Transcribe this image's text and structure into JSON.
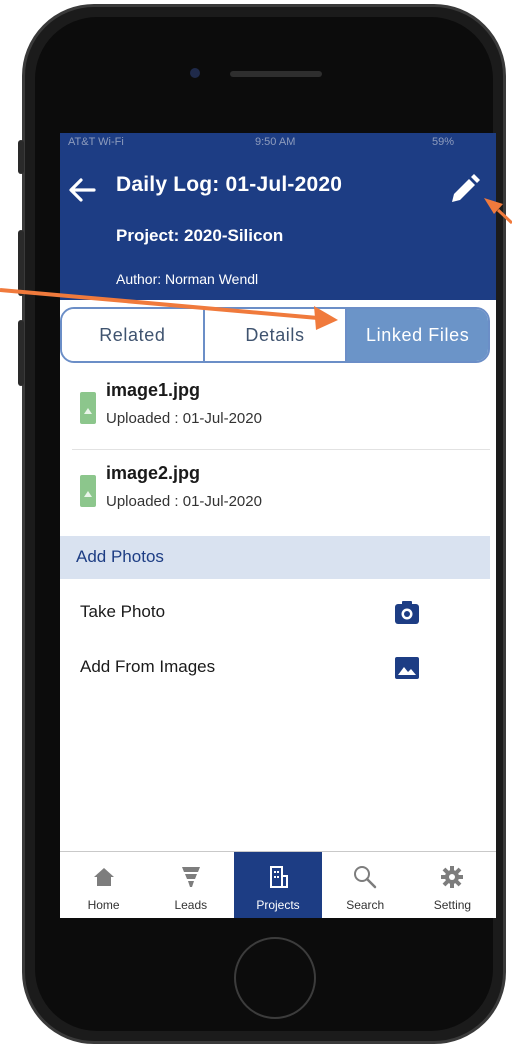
{
  "status_bar": {
    "carrier": "AT&T Wi-Fi",
    "time": "9:50 AM",
    "battery": "59%"
  },
  "header": {
    "title": "Daily Log: 01-Jul-2020",
    "project": "Project: 2020-Silicon",
    "author": "Author: Norman Wendl"
  },
  "tabs": [
    {
      "label": "Related"
    },
    {
      "label": "Details"
    },
    {
      "label": "Linked Files"
    }
  ],
  "files": [
    {
      "name": "image1.jpg",
      "uploaded": "Uploaded : 01-Jul-2020"
    },
    {
      "name": "image2.jpg",
      "uploaded": "Uploaded : 01-Jul-2020"
    }
  ],
  "add_photos": {
    "section_title": "Add Photos",
    "take_photo": "Take Photo",
    "add_from_images": "Add From Images"
  },
  "tabbar": [
    {
      "label": "Home",
      "icon": "home-icon"
    },
    {
      "label": "Leads",
      "icon": "funnel-icon"
    },
    {
      "label": "Projects",
      "icon": "building-icon"
    },
    {
      "label": "Search",
      "icon": "search-icon"
    },
    {
      "label": "Setting",
      "icon": "gear-icon"
    }
  ],
  "colors": {
    "header": "#1d3d84",
    "tab_active": "#6b94c8",
    "section": "#d9e2f0",
    "annotation_arrow": "#f07a3c",
    "file_icon": "#7fbf7f"
  }
}
